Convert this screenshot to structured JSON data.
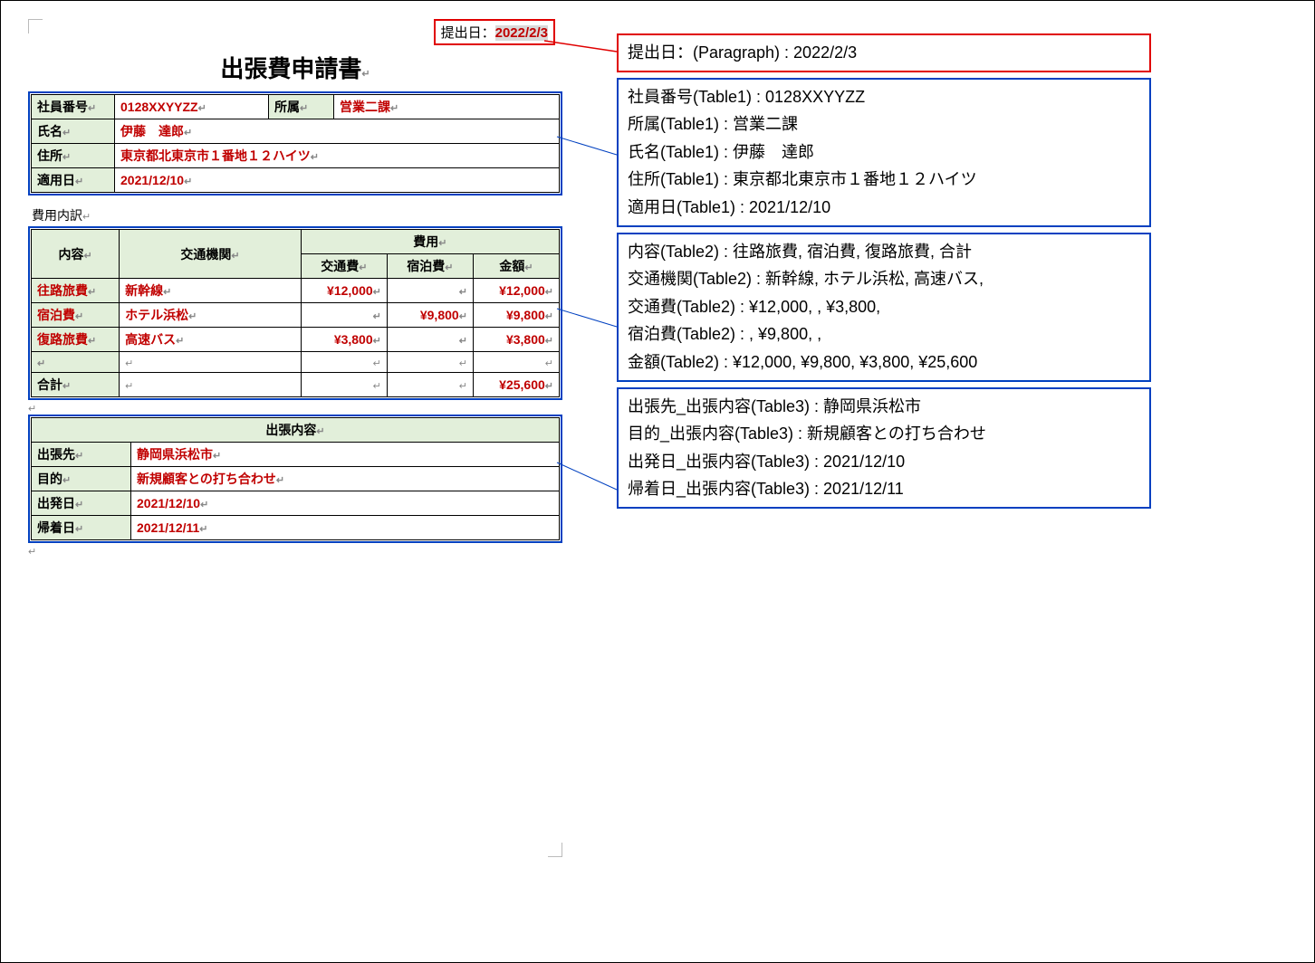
{
  "submit": {
    "label": "提出日：",
    "date": "2022/2/3"
  },
  "title": "出張費申請書",
  "marker": "↵",
  "section_expense_label": "費用内訳",
  "table1": {
    "emp_no_label": "社員番号",
    "emp_no": "0128XXYYZZ",
    "dept_label": "所属",
    "dept": "営業二課",
    "name_label": "氏名",
    "name": "伊藤　達郎",
    "address_label": "住所",
    "address": "東京都北東京市１番地１２ハイツ",
    "apply_date_label": "適用日",
    "apply_date": "2021/12/10"
  },
  "table2": {
    "col_content": "内容",
    "col_transport": "交通機関",
    "col_cost": "費用",
    "sub_trans": "交通費",
    "sub_lodging": "宿泊費",
    "sub_amount": "金額",
    "rows": [
      {
        "content": "往路旅費",
        "transport": "新幹線",
        "trans_cost": "¥12,000",
        "lodging": "",
        "amount": "¥12,000"
      },
      {
        "content": "宿泊費",
        "transport": "ホテル浜松",
        "trans_cost": "",
        "lodging": "¥9,800",
        "amount": "¥9,800"
      },
      {
        "content": "復路旅費",
        "transport": "高速バス",
        "trans_cost": "¥3,800",
        "lodging": "",
        "amount": "¥3,800"
      },
      {
        "content": "",
        "transport": "",
        "trans_cost": "",
        "lodging": "",
        "amount": ""
      }
    ],
    "total_label": "合計",
    "total_amount": "¥25,600"
  },
  "table3": {
    "header": "出張内容",
    "dest_label": "出張先",
    "dest": "静岡県浜松市",
    "purpose_label": "目的",
    "purpose": "新規顧客との打ち合わせ",
    "depart_label": "出発日",
    "depart": "2021/12/10",
    "return_label": "帰着日",
    "return": "2021/12/11"
  },
  "annot": {
    "p": "提出日：(Paragraph) : 2022/2/3",
    "t1": [
      "社員番号(Table1) : 0128XXYYZZ",
      "所属(Table1) : 営業二課",
      "氏名(Table1) : 伊藤　達郎",
      "住所(Table1) : 東京都北東京市１番地１２ハイツ",
      "適用日(Table1) : 2021/12/10"
    ],
    "t2": [
      "内容(Table2) : 往路旅費, 宿泊費, 復路旅費, 合計",
      "交通機関(Table2) : 新幹線, ホテル浜松, 高速バス,",
      "交通費(Table2) : ¥12,000, , ¥3,800,",
      "宿泊費(Table2) : , ¥9,800, ,",
      "金額(Table2) : ¥12,000, ¥9,800, ¥3,800, ¥25,600"
    ],
    "t3": [
      "出張先_出張内容(Table3) : 静岡県浜松市",
      "目的_出張内容(Table3) : 新規顧客との打ち合わせ",
      "出発日_出張内容(Table3) : 2021/12/10",
      "帰着日_出張内容(Table3) : 2021/12/11"
    ]
  }
}
